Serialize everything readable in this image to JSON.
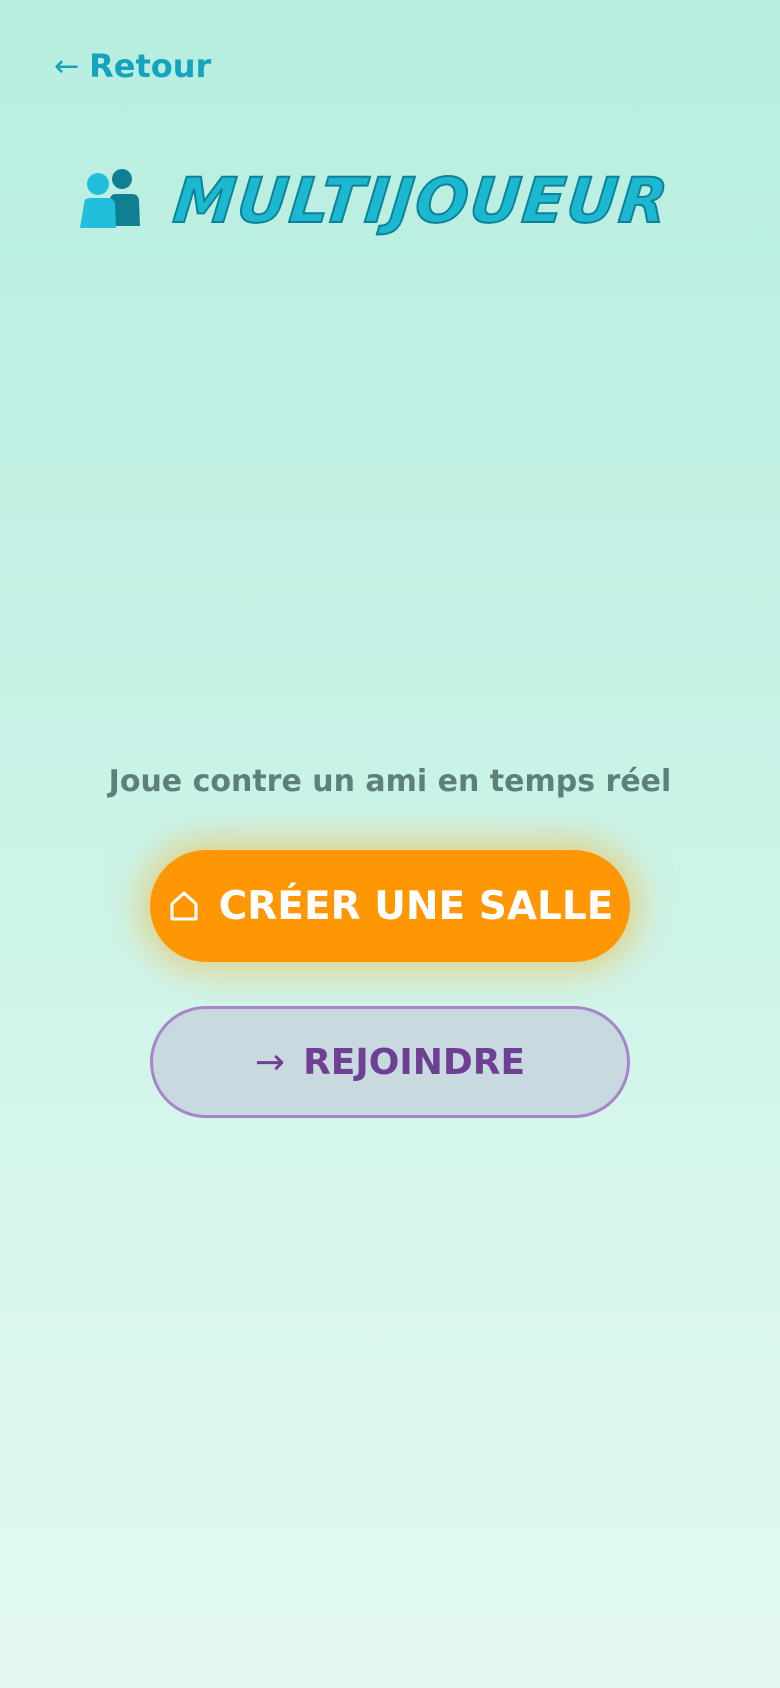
{
  "header": {
    "back_arrow": "←",
    "back_label": "Retour",
    "title": "MULTIJOUEUR",
    "title_icon": "people-icon"
  },
  "main": {
    "subtitle": "Joue contre un ami en temps réel",
    "create_button": {
      "icon": "home-icon",
      "label": "CRÉER UNE SALLE"
    },
    "join_button": {
      "icon": "→",
      "label": "REJOINDRE"
    }
  },
  "colors": {
    "accent": "#15a3bd",
    "title": "#1cb8d1",
    "create_button": "#ff9603",
    "join_button_bg": "#c8d9e0",
    "join_button_border": "#a885c8",
    "join_button_text": "#6e3f92",
    "subtitle": "#5f7f7a"
  }
}
